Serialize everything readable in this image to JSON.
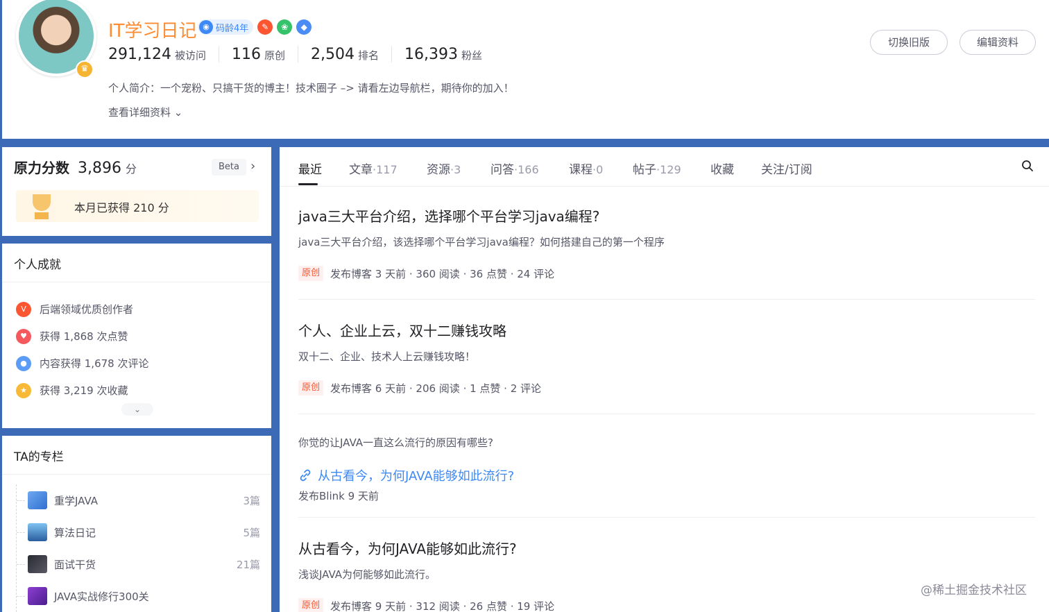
{
  "profile": {
    "name": "IT学习日记",
    "code_age": "码龄4年",
    "stats": [
      {
        "value": "291,124",
        "label": "被访问"
      },
      {
        "value": "116",
        "label": "原创"
      },
      {
        "value": "2,504",
        "label": "排名"
      },
      {
        "value": "16,393",
        "label": "粉丝"
      }
    ],
    "intro": "个人简介：一个宠粉、只搞干货的博主！技术圈子 –> 请看左边导航栏，期待你的加入！",
    "more": "查看详细资料",
    "btn_old": "切换旧版",
    "btn_edit": "编辑资料"
  },
  "score": {
    "title": "原力分数",
    "value": "3,896",
    "unit": "分",
    "beta": "Beta",
    "month": "本月已获得 210 分"
  },
  "achievements": {
    "title": "个人成就",
    "items": [
      "后端领域优质创作者",
      "获得 1,868 次点赞",
      "内容获得 1,678 次评论",
      "获得 3,219 次收藏"
    ]
  },
  "columns": {
    "title": "TA的专栏",
    "items": [
      {
        "name": "重学JAVA",
        "count": "3篇"
      },
      {
        "name": "算法日记",
        "count": "5篇"
      },
      {
        "name": "面试干货",
        "count": "21篇"
      },
      {
        "name": "JAVA实战修行300关",
        "count": ""
      }
    ]
  },
  "tabs": [
    {
      "label": "最近",
      "count": ""
    },
    {
      "label": "文章",
      "count": "·117"
    },
    {
      "label": "资源",
      "count": "·3"
    },
    {
      "label": "问答",
      "count": "·166"
    },
    {
      "label": "课程",
      "count": "·0"
    },
    {
      "label": "帖子",
      "count": "·129"
    },
    {
      "label": "收藏",
      "count": ""
    },
    {
      "label": "关注/订阅",
      "count": ""
    }
  ],
  "posts": [
    {
      "title": "java三大平台介绍，选择哪个平台学习java编程?",
      "desc": "java三大平台介绍，该选择哪个平台学习java编程？如何搭建自己的第一个程序",
      "tag": "原创",
      "meta": "发布博客 3 天前 · 360 阅读 · 36 点赞 · 24 评论"
    },
    {
      "title": "个人、企业上云，双十二赚钱攻略",
      "desc": "双十二、企业、技术人上云赚钱攻略！",
      "tag": "原创",
      "meta": "发布博客 6 天前 · 206 阅读 · 1 点赞 · 2 评论"
    },
    {
      "title": "从古看今，为何JAVA能够如此流行?",
      "desc": "浅谈JAVA为何能够如此流行。",
      "tag": "原创",
      "meta": "发布博客 9 天前 · 312 阅读 · 26 点赞 · 19 评论"
    }
  ],
  "blink": {
    "question": "你觉的让JAVA一直这么流行的原因有哪些?",
    "link": "从古看今，为何JAVA能够如此流行?",
    "meta": "发布Blink 9 天前"
  },
  "watermark": "@稀土掘金技术社区"
}
